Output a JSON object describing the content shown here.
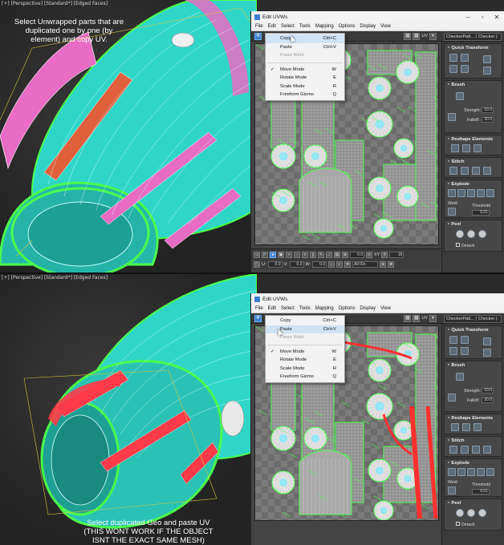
{
  "top": {
    "viewport_label": "[+] [Perspective] [Standard*] [Edged Faces]",
    "caption_lines": [
      "Select Unwrapped parts that are",
      "duplicated one by one (by",
      "element) and copy UV."
    ],
    "window": {
      "title": "Edit UVWs",
      "menus": [
        "File",
        "Edit",
        "Select",
        "Tools",
        "Mapping",
        "Options",
        "Display",
        "View"
      ],
      "uv_label": "UV",
      "checker": "CheckerPatt... ( Checker )",
      "context_menu": [
        {
          "label": "Copy",
          "shortcut": "Ctrl+C",
          "state": "highlighted"
        },
        {
          "label": "Paste",
          "shortcut": "Ctrl+V",
          "state": "normal"
        },
        {
          "label": "Paste  Weld",
          "shortcut": "",
          "state": "disabled"
        },
        {
          "sep": true
        },
        {
          "label": "Move Mode",
          "shortcut": "W",
          "state": "checked"
        },
        {
          "label": "Rotate Mode",
          "shortcut": "E",
          "state": "normal"
        },
        {
          "label": "Scale Mode",
          "shortcut": "R",
          "state": "normal"
        },
        {
          "label": "Freeform Gizmo",
          "shortcut": "Q",
          "state": "normal"
        }
      ]
    }
  },
  "bottom": {
    "viewport_label": "[+] [Perspective] [Standard*] [Edged Faces]",
    "caption_lines": [
      "Select duplicated Geo and paste UV",
      "(THIS WONT WORK IF THE OBJECT",
      "ISNT THE EXACT SAME MESH)"
    ],
    "window": {
      "title": "Edit UVWs",
      "menus": [
        "File",
        "Edit",
        "Select",
        "Tools",
        "Mapping",
        "Options",
        "Display",
        "View"
      ],
      "uv_label": "UV",
      "checker": "CheckerPatt... ( Checker )",
      "context_menu": [
        {
          "label": "Copy",
          "shortcut": "Ctrl+C",
          "state": "normal"
        },
        {
          "label": "Paste",
          "shortcut": "Ctrl+V",
          "state": "highlighted"
        },
        {
          "label": "Paste  Weld",
          "shortcut": "",
          "state": "disabled"
        },
        {
          "sep": true
        },
        {
          "label": "Move Mode",
          "shortcut": "W",
          "state": "checked"
        },
        {
          "label": "Rotate Mode",
          "shortcut": "E",
          "state": "normal"
        },
        {
          "label": "Scale Mode",
          "shortcut": "R",
          "state": "normal"
        },
        {
          "label": "Freeform Gizmo",
          "shortcut": "Q",
          "state": "normal"
        }
      ]
    }
  },
  "sidebar": {
    "quick_transform": "Quick Transform",
    "brush": "Brush",
    "strength_label": "Strength:",
    "strength_value": "10.0",
    "falloff_label": "Falloff:",
    "falloff_value": "20.0",
    "reshape": "Reshape Elements",
    "stitch": "Stitch",
    "explode": "Explode",
    "weld": "Weld",
    "threshold_label": "Threshold",
    "threshold_value": "0.01",
    "peel": "Peel",
    "detach": "Detach"
  },
  "bottombar": {
    "u_label": "U:",
    "u_value": "0.0",
    "v_label": "V:",
    "v_value": "0.0",
    "w_label": "W:",
    "w_value": "0.0",
    "ids": "All IDs",
    "xy": "XY",
    "grid_value": "16"
  },
  "colors": {
    "mesh": "#2fd6c8",
    "wire": "#4bff4b",
    "pink": "#e86cc3",
    "red": "#ff3030",
    "uv_bg": "#7b7b7b"
  }
}
